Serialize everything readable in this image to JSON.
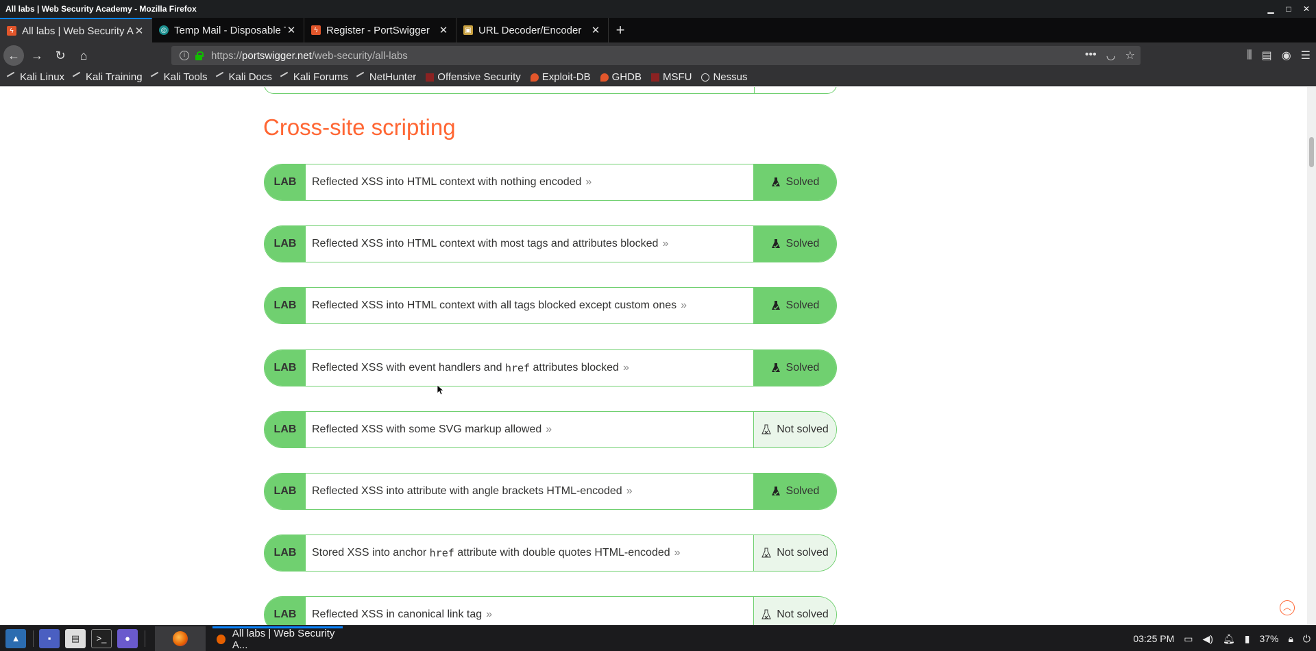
{
  "window": {
    "title": "All labs | Web Security Academy - Mozilla Firefox"
  },
  "tabs": [
    {
      "label": "All labs | Web Security A",
      "icon": "portswigger-icon",
      "active": true
    },
    {
      "label": "Temp Mail - Disposable T",
      "icon": "tempmail-icon",
      "active": false
    },
    {
      "label": "Register - PortSwigger",
      "icon": "portswigger-icon",
      "active": false
    },
    {
      "label": "URL Decoder/Encoder",
      "icon": "urldecoder-icon",
      "active": false
    }
  ],
  "navbar": {
    "url_prefix": "https://",
    "url_host": "portswigger.net",
    "url_path": "/web-security/all-labs"
  },
  "bookmarks": [
    {
      "label": "Kali Linux",
      "icon": "kali-icon"
    },
    {
      "label": "Kali Training",
      "icon": "kali-icon"
    },
    {
      "label": "Kali Tools",
      "icon": "kali-icon"
    },
    {
      "label": "Kali Docs",
      "icon": "kali-icon"
    },
    {
      "label": "Kali Forums",
      "icon": "kali-icon"
    },
    {
      "label": "NetHunter",
      "icon": "kali-icon"
    },
    {
      "label": "Offensive Security",
      "icon": "offsec-icon"
    },
    {
      "label": "Exploit-DB",
      "icon": "exploitdb-icon"
    },
    {
      "label": "GHDB",
      "icon": "exploitdb-icon"
    },
    {
      "label": "MSFU",
      "icon": "offsec-icon"
    },
    {
      "label": "Nessus",
      "icon": "globe-icon"
    }
  ],
  "section": {
    "title": "Cross-site scripting"
  },
  "labs": [
    {
      "tag": "LAB",
      "parts": [
        "Reflected XSS into HTML context with nothing encoded"
      ],
      "code": "",
      "tail": "",
      "status": "Solved",
      "solved": true
    },
    {
      "tag": "LAB",
      "parts": [
        "Reflected XSS into HTML context with most tags and attributes blocked"
      ],
      "code": "",
      "tail": "",
      "status": "Solved",
      "solved": true
    },
    {
      "tag": "LAB",
      "parts": [
        "Reflected XSS into HTML context with all tags blocked except custom ones"
      ],
      "code": "",
      "tail": "",
      "status": "Solved",
      "solved": true
    },
    {
      "tag": "LAB",
      "parts": [
        "Reflected XSS with event handlers and "
      ],
      "code": "href",
      "tail": " attributes blocked",
      "status": "Solved",
      "solved": true
    },
    {
      "tag": "LAB",
      "parts": [
        "Reflected XSS with some SVG markup allowed"
      ],
      "code": "",
      "tail": "",
      "status": "Not solved",
      "solved": false
    },
    {
      "tag": "LAB",
      "parts": [
        "Reflected XSS into attribute with angle brackets HTML-encoded"
      ],
      "code": "",
      "tail": "",
      "status": "Solved",
      "solved": true
    },
    {
      "tag": "LAB",
      "parts": [
        "Stored XSS into anchor "
      ],
      "code": "href",
      "tail": " attribute with double quotes HTML-encoded",
      "status": "Not solved",
      "solved": false
    },
    {
      "tag": "LAB",
      "parts": [
        "Reflected XSS in canonical link tag"
      ],
      "code": "",
      "tail": "",
      "status": "Not solved",
      "solved": false
    }
  ],
  "taskbar": {
    "task_label": "All labs | Web Security A...",
    "clock": "03:25 PM",
    "battery": "37%"
  },
  "colors": {
    "accent_orange": "#ff6633",
    "lab_green": "#70d070",
    "unsolved_bg": "#eaf6ea"
  }
}
